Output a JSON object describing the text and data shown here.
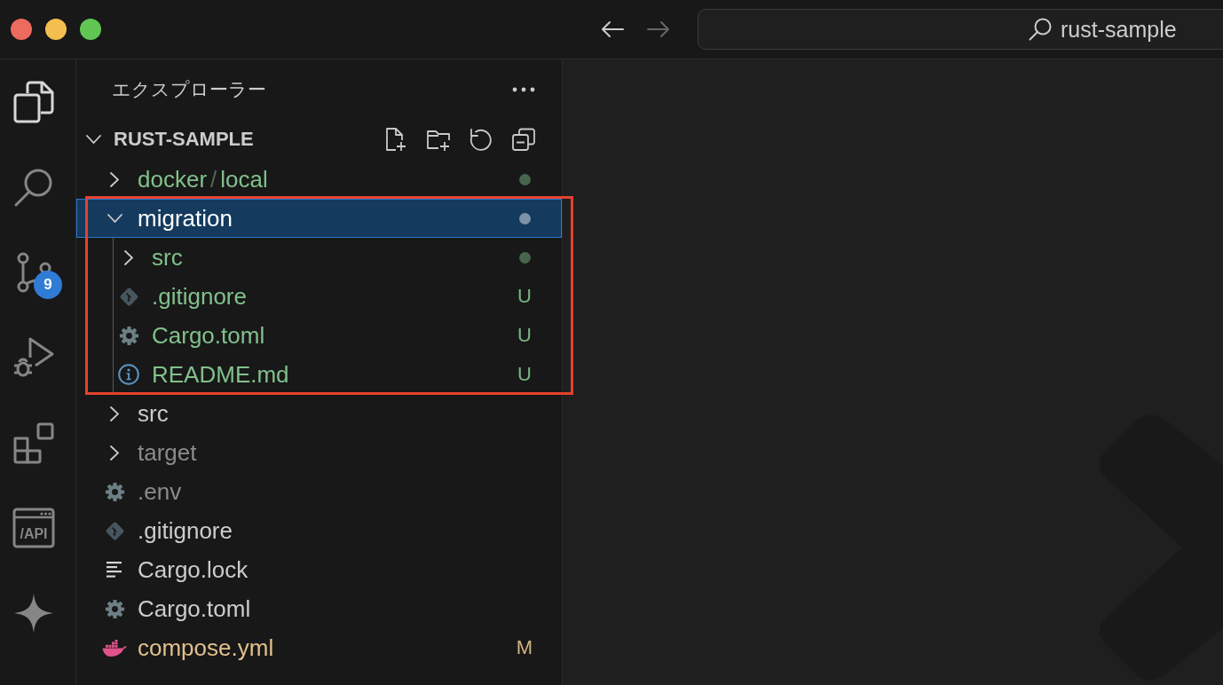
{
  "title_bar": {
    "back": {
      "disabled": false
    },
    "forward": {
      "disabled": true
    },
    "command_center": {
      "label": "rust-sample"
    }
  },
  "activity_bar": {
    "items": [
      {
        "kind": "explorer",
        "selected": true
      },
      {
        "kind": "search",
        "selected": false
      },
      {
        "kind": "scm",
        "selected": false,
        "badge": "9"
      },
      {
        "kind": "debug",
        "selected": false
      },
      {
        "kind": "extensions",
        "selected": false
      },
      {
        "kind": "api",
        "selected": false,
        "label": "/API"
      },
      {
        "kind": "sparkle",
        "selected": false
      }
    ]
  },
  "explorer": {
    "title": "エクスプローラー",
    "section": {
      "title": "RUST-SAMPLE",
      "expanded": true
    },
    "tree": [
      {
        "kind": "folder",
        "name_parts": [
          "docker",
          "local"
        ],
        "separator": "/",
        "expanded": false,
        "selected": false,
        "highlighted": false,
        "color": "#81c08b",
        "change_dot": true
      },
      {
        "kind": "folder",
        "name": "migration",
        "expanded": true,
        "selected": true,
        "highlighted": true,
        "color": "#ffffff",
        "change_dot": true,
        "children": [
          {
            "kind": "folder",
            "name": "src",
            "expanded": false,
            "selected": false,
            "highlighted": false,
            "color": "#81c08b",
            "change_dot": true
          },
          {
            "kind": "git",
            "name": ".gitignore",
            "selected": false,
            "highlighted": false,
            "color": "#81c08b",
            "decoration": "U"
          },
          {
            "kind": "settings",
            "name": "Cargo.toml",
            "selected": false,
            "highlighted": false,
            "color": "#81c08b",
            "decoration": "U"
          },
          {
            "kind": "info",
            "name": "README.md",
            "selected": false,
            "highlighted": false,
            "color": "#81c08b",
            "decoration": "U"
          }
        ]
      },
      {
        "kind": "folder",
        "name": "src",
        "expanded": false,
        "selected": false,
        "highlighted": false,
        "color": "#cccccc",
        "change_dot": false
      },
      {
        "kind": "folder",
        "name": "target",
        "expanded": false,
        "selected": false,
        "highlighted": false,
        "color": "#8b8b8b",
        "change_dot": false
      },
      {
        "kind": "settings",
        "name": ".env",
        "selected": false,
        "highlighted": false,
        "color": "#8b8b8b"
      },
      {
        "kind": "git",
        "name": ".gitignore",
        "selected": false,
        "highlighted": false,
        "color": "#cccccc"
      },
      {
        "kind": "lines",
        "name": "Cargo.lock",
        "selected": false,
        "highlighted": false,
        "color": "#cccccc"
      },
      {
        "kind": "settings",
        "name": "Cargo.toml",
        "selected": false,
        "highlighted": false,
        "color": "#cccccc"
      },
      {
        "kind": "docker",
        "name": "compose.yml",
        "selected": false,
        "highlighted": false,
        "color": "#e2c08d",
        "decoration": "M"
      }
    ]
  }
}
